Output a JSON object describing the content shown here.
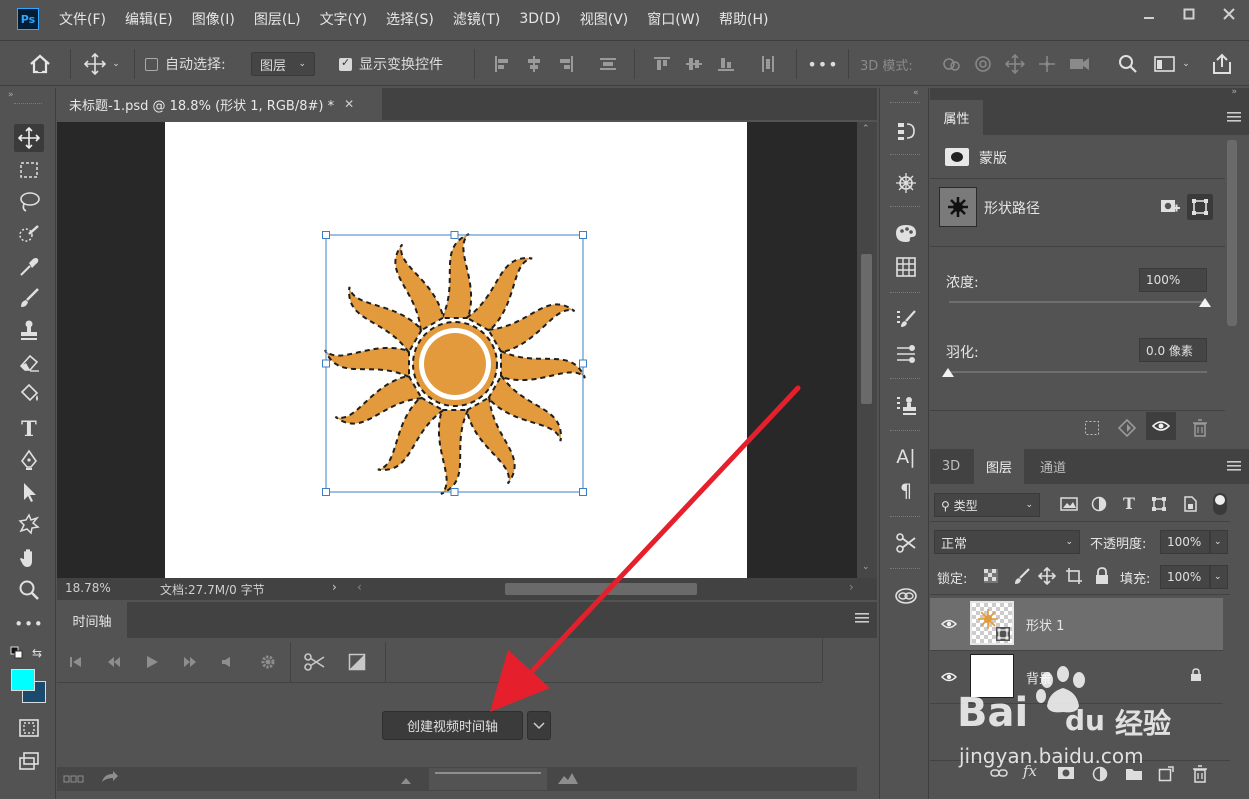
{
  "app": {
    "logo": "Ps",
    "menu": [
      "文件(F)",
      "编辑(E)",
      "图像(I)",
      "图层(L)",
      "文字(Y)",
      "选择(S)",
      "滤镜(T)",
      "3D(D)",
      "视图(V)",
      "窗口(W)",
      "帮助(H)"
    ]
  },
  "options_bar": {
    "auto_select_label": "自动选择:",
    "auto_select_value": "图层",
    "show_transform_label": "显示变换控件",
    "mode_3d_label": "3D 模式:",
    "more_label": "•••"
  },
  "document": {
    "tab_title": "未标题-1.psd @ 18.8% (形状 1, RGB/8#) *",
    "zoom": "18.78%",
    "doc_info": "文档:27.7M/0 字节",
    "shape_fill": "#e29a3c"
  },
  "timeline": {
    "tab_label": "时间轴",
    "create_button": "创建视频时间轴"
  },
  "properties": {
    "tab_label": "属性",
    "mask_label": "蒙版",
    "shape_path_label": "形状路径",
    "density_label": "浓度:",
    "density_value": "100%",
    "feather_label": "羽化:",
    "feather_value": "0.0 像素"
  },
  "layers_panel": {
    "tabs": [
      "3D",
      "图层",
      "通道"
    ],
    "filter_label": "类型",
    "blend_mode": "正常",
    "opacity_label": "不透明度:",
    "opacity_value": "100%",
    "lock_label": "锁定:",
    "fill_label": "填充:",
    "fill_value": "100%",
    "layers": [
      {
        "name": "形状 1"
      },
      {
        "name": "背景"
      }
    ]
  },
  "watermark": {
    "brand": "Bai",
    "brand2": "du",
    "product": "经验",
    "url": "jingyan.baidu.com"
  },
  "colors": {
    "foreground": "#00ffff",
    "background": "#1a4a6e",
    "arrow": "#e5202c"
  }
}
